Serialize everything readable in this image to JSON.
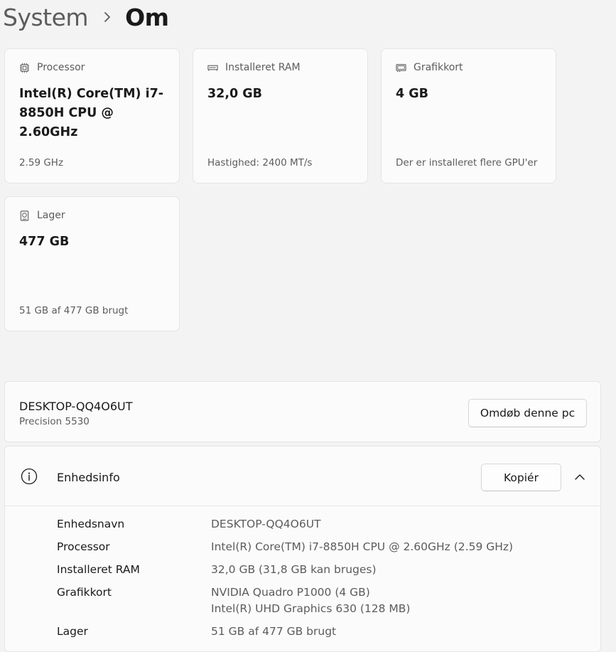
{
  "breadcrumb": {
    "parent": "System",
    "current": "Om"
  },
  "cards": {
    "processor": {
      "title": "Processor",
      "value": "Intel(R) Core(TM) i7-8850H CPU @ 2.60GHz",
      "foot": "2.59 GHz",
      "icon": "cpu-icon"
    },
    "ram": {
      "title": "Installeret RAM",
      "value": "32,0 GB",
      "foot": "Hastighed: 2400 MT/s",
      "icon": "memory-icon"
    },
    "gpu": {
      "title": "Grafikkort",
      "value": "4 GB",
      "foot": "Der er installeret flere GPU'er",
      "icon": "gpu-icon"
    },
    "storage": {
      "title": "Lager",
      "value": "477 GB",
      "foot": "51 GB af 477 GB brugt",
      "icon": "storage-icon"
    }
  },
  "device": {
    "name": "DESKTOP-QQ4O6UT",
    "model": "Precision 5530",
    "rename_label": "Omdøb denne pc"
  },
  "device_info": {
    "title": "Enhedsinfo",
    "copy_label": "Kopiér",
    "icons": {
      "info": "info-icon",
      "collapse": "chevron-up-icon"
    },
    "rows": [
      {
        "label": "Enhedsnavn",
        "value": "DESKTOP-QQ4O6UT"
      },
      {
        "label": "Processor",
        "value": "Intel(R) Core(TM) i7-8850H CPU @ 2.60GHz (2.59 GHz)"
      },
      {
        "label": "Installeret RAM",
        "value": "32,0 GB (31,8 GB kan bruges)"
      },
      {
        "label": "Grafikkort",
        "value": "NVIDIA Quadro P1000 (4 GB)",
        "value2": "Intel(R) UHD Graphics 630 (128 MB)"
      },
      {
        "label": "Lager",
        "value": "51 GB af 477 GB brugt"
      }
    ]
  },
  "colors": {
    "background": "#f3f3f3",
    "card": "#fbfbfb",
    "border": "#e5e5e5",
    "secondary_text": "#5c5c5c"
  }
}
